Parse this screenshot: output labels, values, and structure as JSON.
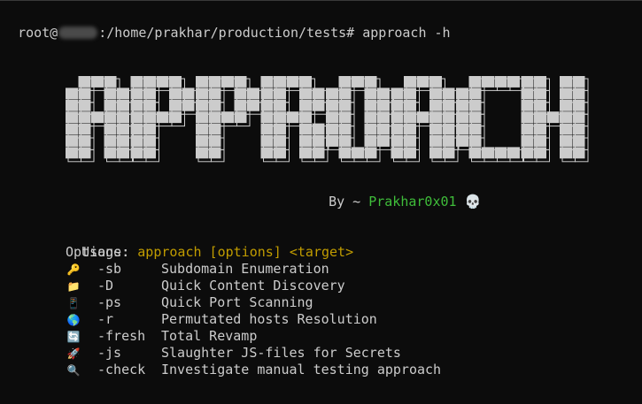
{
  "terminal": {
    "prompt_user": "root@",
    "prompt_path": ":/home/prakhar/production/tests#",
    "command": "approach -h"
  },
  "banner": {
    "text": "APPROACH",
    "fill_color": "#cccccc",
    "outline_color": "#cccccc"
  },
  "byline": {
    "prefix": "By ~",
    "author": "Prakhar0x01",
    "emoji": "💀"
  },
  "usage": {
    "label": "Usage:",
    "syntax": "approach [options] <target>"
  },
  "options_title": "Options:",
  "options": [
    {
      "icon": "key-icon",
      "glyph": "🔑",
      "flag": "-sb",
      "desc": "Subdomain Enumeration"
    },
    {
      "icon": "folder-icon",
      "glyph": "📁",
      "flag": "-D",
      "desc": "Quick Content Discovery"
    },
    {
      "icon": "phone-icon",
      "glyph": "📱",
      "flag": "-ps",
      "desc": "Quick Port Scanning"
    },
    {
      "icon": "globe-icon",
      "glyph": "🌎",
      "flag": "-r",
      "desc": "Permutated hosts Resolution"
    },
    {
      "icon": "refresh-icon",
      "glyph": "🔄",
      "flag": "-fresh",
      "desc": "Total Revamp"
    },
    {
      "icon": "rocket-icon",
      "glyph": "🚀",
      "flag": "-js",
      "desc": "Slaughter JS-files for Secrets"
    },
    {
      "icon": "magnifier-icon",
      "glyph": "🔍",
      "flag": "-check",
      "desc": "Investigate manual testing approach"
    }
  ],
  "colors": {
    "background": "#0c0c0c",
    "text": "#cccccc",
    "author": "#3fbd3a",
    "usage_syntax": "#c19c00"
  }
}
